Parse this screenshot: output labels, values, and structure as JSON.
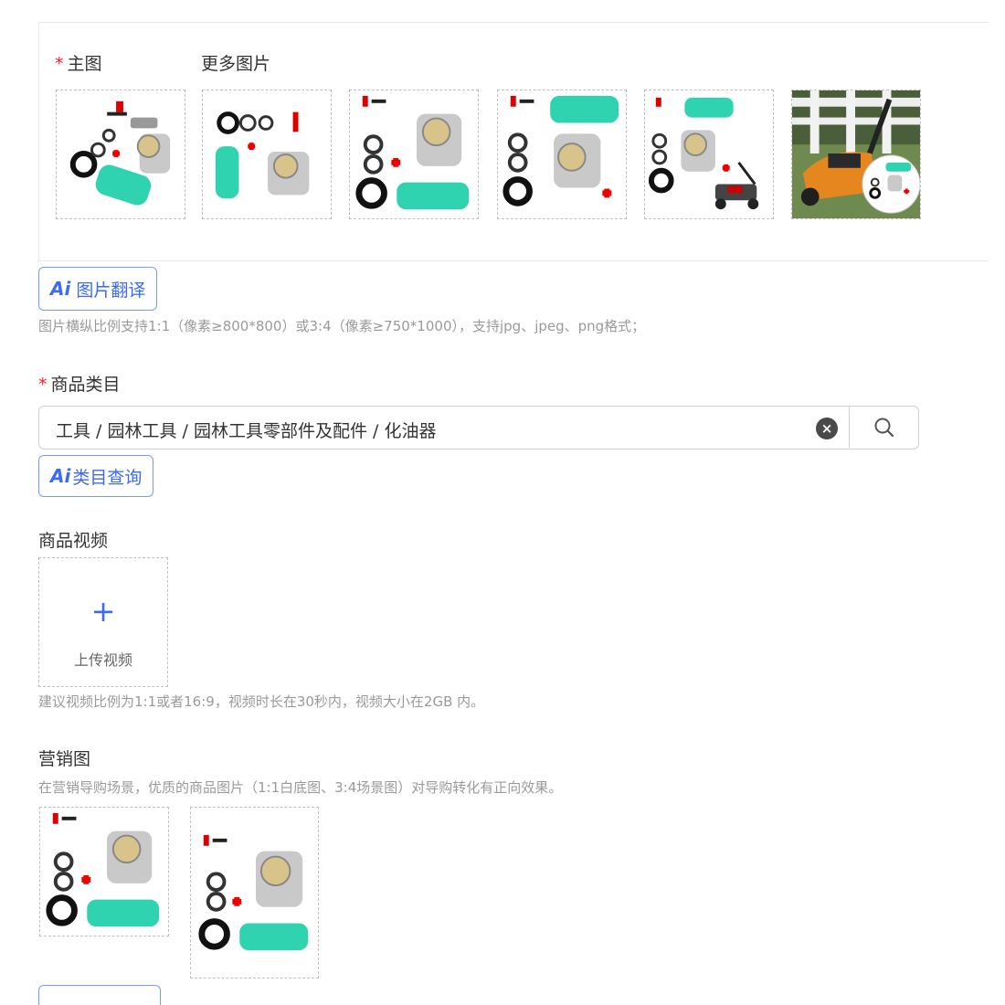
{
  "images": {
    "main_label": "主图",
    "more_label": "更多图片",
    "thumbnails": [
      {
        "name": "carburetor-kit-main"
      },
      {
        "name": "carburetor-kit-alt-1"
      },
      {
        "name": "carburetor-kit-alt-2"
      },
      {
        "name": "carburetor-kit-alt-3"
      },
      {
        "name": "carburetor-kit-with-mower"
      },
      {
        "name": "lawn-mower-scene"
      }
    ],
    "translate_ai": "Ai",
    "translate_label": "图片翻译",
    "hint": "图片横纵比例支持1:1（像素≥800*800）或3:4（像素≥750*1000），支持jpg、jpeg、png格式；"
  },
  "category": {
    "label": "商品类目",
    "value": "工具 / 园林工具 / 园林工具零部件及配件 / 化油器",
    "query_ai": "Ai",
    "query_label": "类目查询"
  },
  "video": {
    "label": "商品视频",
    "plus": "+",
    "upload_label": "上传视频",
    "hint": "建议视频比例为1:1或者16:9，视频时长在30秒内，视频大小在2GB 内。"
  },
  "marketing": {
    "label": "营销图",
    "hint": "在营销导购场景，优质的商品图片（1:1白底图、3:4场景图）对导购转化有正向效果。"
  },
  "icons": {
    "clear": "clear-icon",
    "search": "search-icon",
    "plus": "plus-icon"
  },
  "colors": {
    "accent": "#3d6af2",
    "required": "#f5222d",
    "filter_teal": "#2fd3b0"
  }
}
